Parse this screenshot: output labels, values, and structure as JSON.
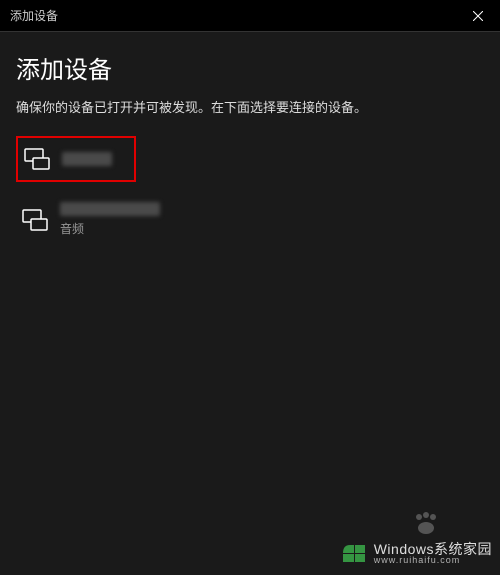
{
  "titlebar": {
    "title": "添加设备"
  },
  "dialog": {
    "heading": "添加设备",
    "subheading": "确保你的设备已打开并可被发现。在下面选择要连接的设备。"
  },
  "devices": [
    {
      "name": "",
      "sub": ""
    },
    {
      "name": "",
      "sub": "音频"
    }
  ],
  "watermark": {
    "main": "Windows系统家园",
    "sub": "www.ruihaifu.com"
  }
}
